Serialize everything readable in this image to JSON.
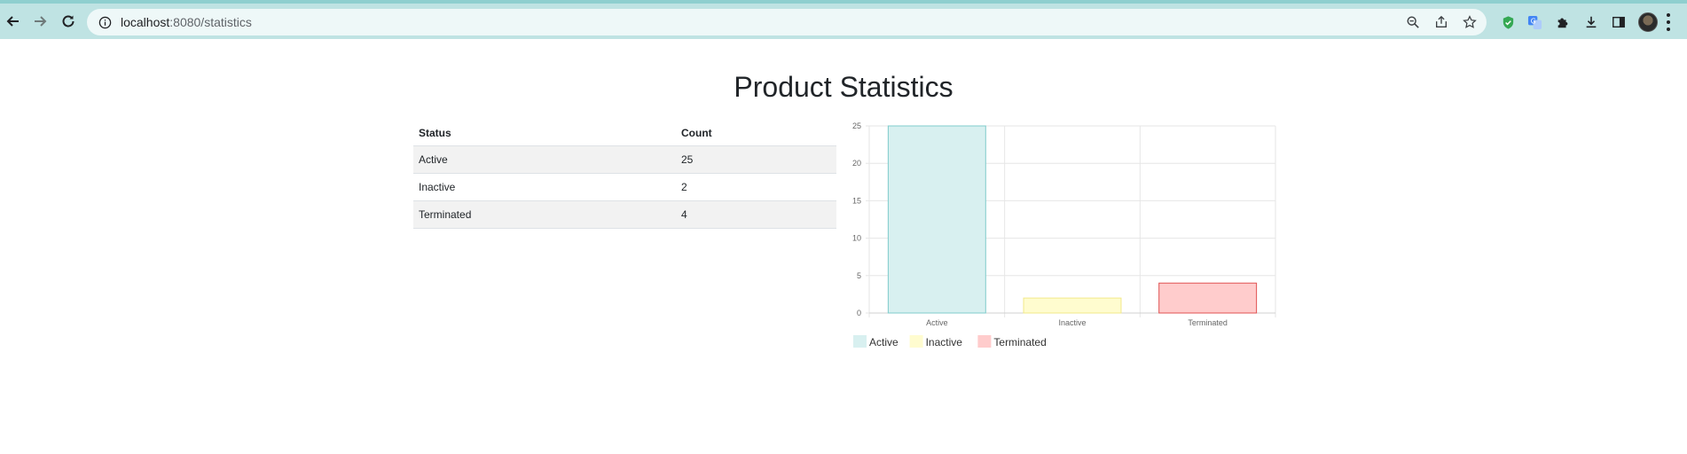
{
  "browser": {
    "url_host": "localhost",
    "url_rest": ":8080/statistics"
  },
  "page": {
    "title": "Product Statistics"
  },
  "table": {
    "headers": [
      "Status",
      "Count"
    ],
    "rows": [
      {
        "status": "Active",
        "count": "25"
      },
      {
        "status": "Inactive",
        "count": "2"
      },
      {
        "status": "Terminated",
        "count": "4"
      }
    ]
  },
  "chart_data": {
    "type": "bar",
    "categories": [
      "Active",
      "Inactive",
      "Terminated"
    ],
    "values": [
      25,
      2,
      4
    ],
    "ylim": [
      0,
      25
    ],
    "yticks": [
      "0",
      "5",
      "10",
      "15",
      "20",
      "25"
    ],
    "grid": true,
    "legend_position": "bottom-left",
    "legend": [
      "Active",
      "Inactive",
      "Terminated"
    ],
    "fill_colors": [
      "#d8f0f0",
      "#fffccf",
      "#ffcccc"
    ],
    "stroke_colors": [
      "#7fcccc",
      "#f2e98a",
      "#e05252"
    ]
  }
}
